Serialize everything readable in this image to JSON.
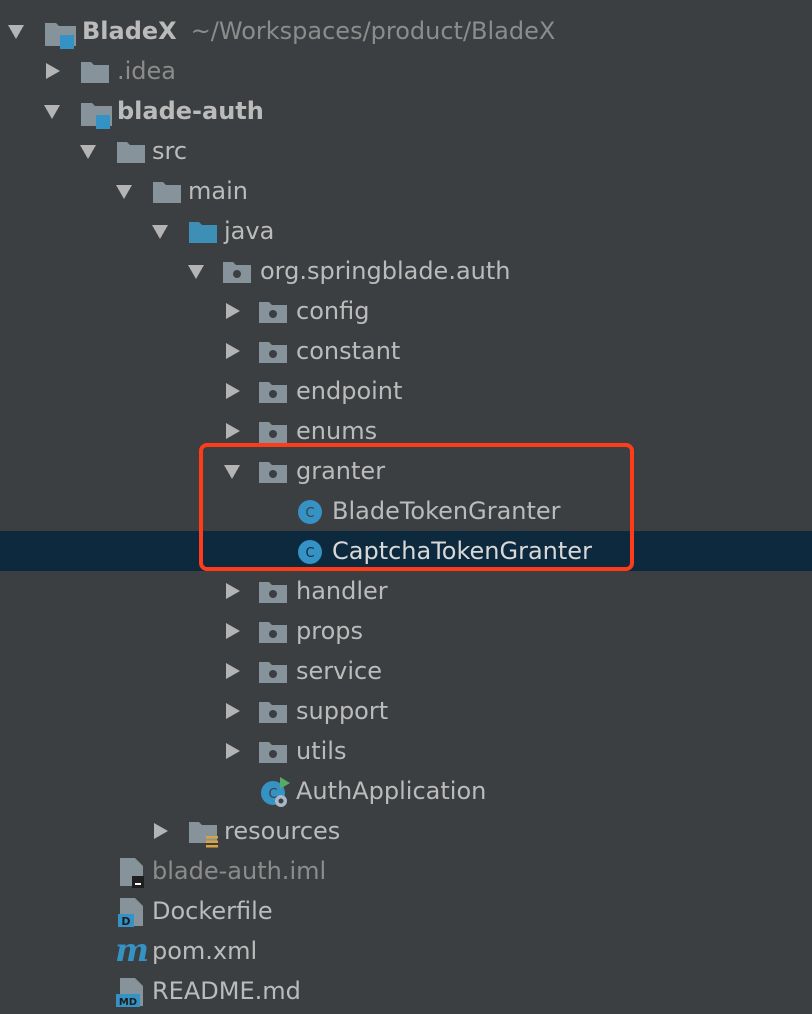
{
  "root": {
    "label": "BladeX",
    "path": "~/Workspaces/product/BladeX"
  },
  "items": {
    "idea": ".idea",
    "blade_auth": "blade-auth",
    "src": "src",
    "main": "main",
    "java": "java",
    "pkg": "org.springblade.auth",
    "config": "config",
    "constant": "constant",
    "endpoint": "endpoint",
    "enums": "enums",
    "granter": "granter",
    "blade_token_granter": "BladeTokenGranter",
    "captcha_token_granter": "CaptchaTokenGranter",
    "handler": "handler",
    "props": "props",
    "service": "service",
    "support": "support",
    "utils": "utils",
    "auth_application": "AuthApplication",
    "resources": "resources",
    "iml": "blade-auth.iml",
    "dockerfile": "Dockerfile",
    "pom": "pom.xml",
    "readme": "README.md"
  },
  "icon_text": {
    "class": "C",
    "maven": "m",
    "dockerfile": "D",
    "markdown": "MD"
  },
  "colors": {
    "background": "#3c3f41",
    "selection": "#0d293e",
    "highlight": "#ff3c1a",
    "folder": "#87939a",
    "source_folder": "#3d8fb5",
    "class_icon": "#3592c4"
  }
}
